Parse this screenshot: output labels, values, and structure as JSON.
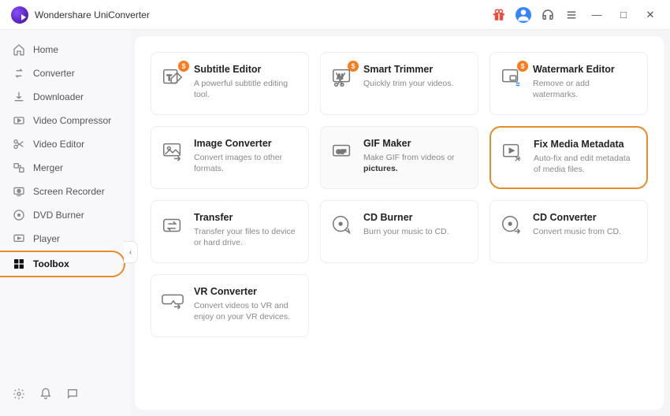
{
  "titlebar": {
    "app_name": "Wondershare UniConverter"
  },
  "sidebar": {
    "items": [
      {
        "label": "Home"
      },
      {
        "label": "Converter"
      },
      {
        "label": "Downloader"
      },
      {
        "label": "Video Compressor"
      },
      {
        "label": "Video Editor"
      },
      {
        "label": "Merger"
      },
      {
        "label": "Screen Recorder"
      },
      {
        "label": "DVD Burner"
      },
      {
        "label": "Player"
      },
      {
        "label": "Toolbox"
      }
    ]
  },
  "tools": [
    {
      "title": "Subtitle Editor",
      "desc": "A powerful subtitle editing tool.",
      "badge": "$"
    },
    {
      "title": "Smart Trimmer",
      "desc": "Quickly trim your videos.",
      "badge": "$"
    },
    {
      "title": "Watermark Editor",
      "desc": "Remove or add watermarks.",
      "badge": "$"
    },
    {
      "title": "Image Converter",
      "desc": "Convert images to other formats."
    },
    {
      "title": "GIF Maker",
      "desc_html": "Make GIF from videos or <strong>pictures.</strong>"
    },
    {
      "title": "Fix Media Metadata",
      "desc": "Auto-fix and edit metadata of media files."
    },
    {
      "title": "Transfer",
      "desc": "Transfer your files to device or hard drive."
    },
    {
      "title": "CD Burner",
      "desc": "Burn your music to CD."
    },
    {
      "title": "CD Converter",
      "desc": "Convert music from CD."
    },
    {
      "title": "VR Converter",
      "desc": "Convert videos to VR and enjoy on your VR devices."
    }
  ]
}
